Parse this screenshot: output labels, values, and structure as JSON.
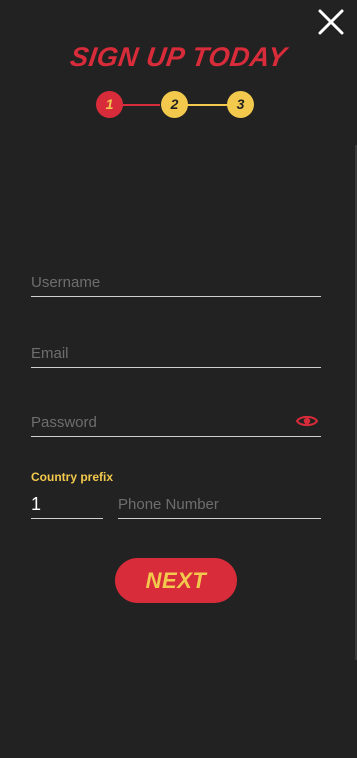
{
  "title": "SIGN UP TODAY",
  "stepper": {
    "steps": [
      "1",
      "2",
      "3"
    ],
    "current": 1
  },
  "form": {
    "username_placeholder": "Username",
    "email_placeholder": "Email",
    "password_placeholder": "Password",
    "country_prefix_label": "Country prefix",
    "country_prefix_value": "1",
    "phone_placeholder": "Phone Number",
    "next_label": "NEXT"
  },
  "icons": {
    "close": "close-icon",
    "password_toggle": "eye-icon"
  },
  "colors": {
    "background": "#232222",
    "accent_red": "#d82c3b",
    "accent_yellow": "#f2c94c",
    "input_underline": "#cfcfcf",
    "placeholder": "#6e6e6e"
  }
}
